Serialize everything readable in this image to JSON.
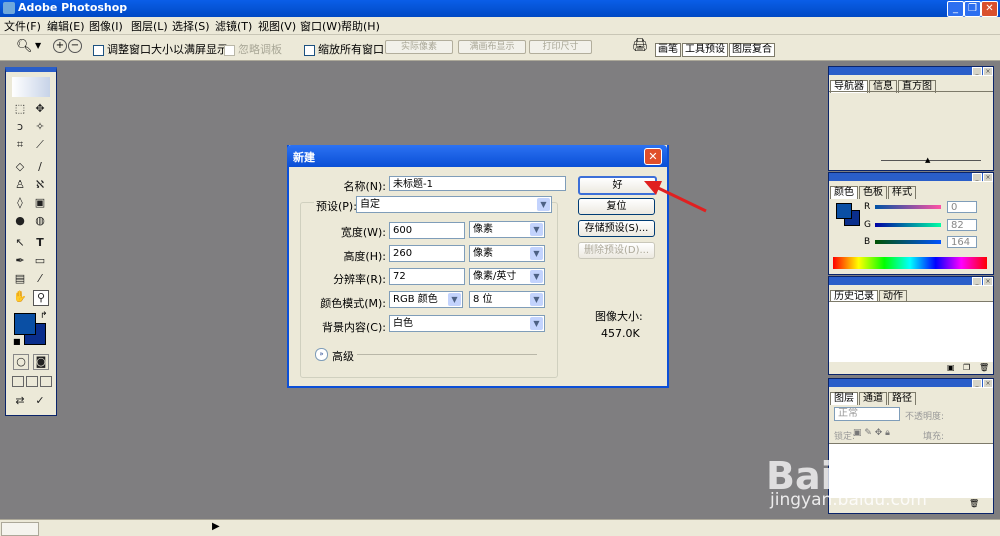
{
  "app": {
    "title": "Adobe Photoshop",
    "window_buttons": {
      "minimize": "_",
      "restore": "❐",
      "close": "✕"
    }
  },
  "menu": [
    "文件(F)",
    "编辑(E)",
    "图像(I)",
    "图层(L)",
    "选择(S)",
    "滤镜(T)",
    "视图(V)",
    "窗口(W)",
    "帮助(H)"
  ],
  "options": {
    "resize_windows_label": "调整窗口大小以满屏显示",
    "ignore_palettes_label": "忽略调板",
    "zoom_all_label": "缩放所有窗口",
    "actual_pixels_label": "实际像素",
    "fit_screen_label": "满画布显示",
    "print_size_label": "打印尺寸",
    "docked_tabs": [
      "画笔",
      "工具预设",
      "图层复合"
    ]
  },
  "dialog": {
    "title": "新建",
    "name_label": "名称(N):",
    "name_value": "未标题-1",
    "preset_label": "预设(P):",
    "preset_value": "自定",
    "width_label": "宽度(W):",
    "width_value": "600",
    "width_unit": "像素",
    "height_label": "高度(H):",
    "height_value": "260",
    "height_unit": "像素",
    "resolution_label": "分辨率(R):",
    "resolution_value": "72",
    "resolution_unit": "像素/英寸",
    "mode_label": "颜色模式(M):",
    "mode_value": "RGB 颜色",
    "bits_value": "8 位",
    "background_label": "背景内容(C):",
    "background_value": "白色",
    "advanced_label": "高级",
    "ok_label": "好",
    "reset_label": "复位",
    "save_preset_label": "存储预设(S)...",
    "delete_preset_label": "删除预设(D)...",
    "image_size_label": "图像大小:",
    "image_size_value": "457.0K"
  },
  "palettes": {
    "navigator_tabs": [
      "导航器",
      "信息",
      "直方图"
    ],
    "color_tabs": [
      "颜色",
      "色板",
      "样式"
    ],
    "color_channels": [
      {
        "label": "R",
        "value": "0"
      },
      {
        "label": "G",
        "value": "82"
      },
      {
        "label": "B",
        "value": "164"
      }
    ],
    "history_tabs": [
      "历史记录",
      "动作"
    ],
    "layers_tabs": [
      "图层",
      "通道",
      "路径"
    ],
    "layers_blend_mode": "正常",
    "layers_opacity_label": "不透明度:",
    "layers_lock_label": "锁定:",
    "layers_fill_label": "填充:"
  },
  "colors": {
    "foreground": "#0a4fa4",
    "background": "#0a2e8c",
    "titlebar": "#0a5ee8",
    "canvas_bg": "#7f7e80"
  },
  "watermark": {
    "logo": "Bai du 经验",
    "url": "jingyan.baidu.com"
  }
}
